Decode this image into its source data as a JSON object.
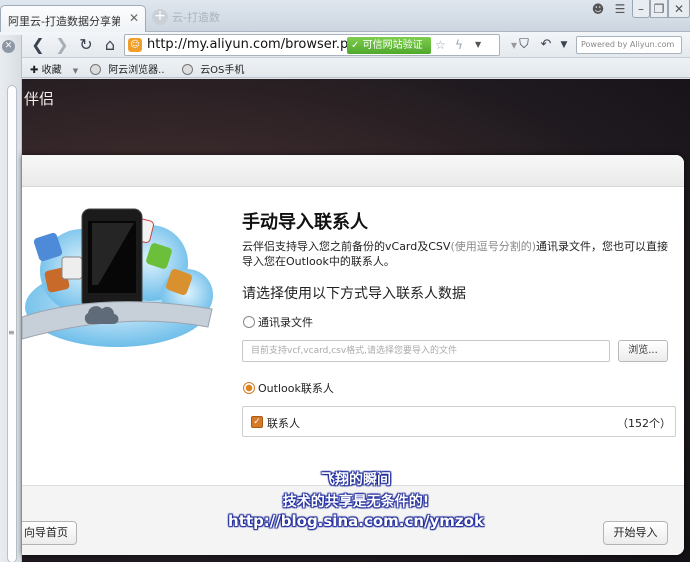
{
  "browser": {
    "tab_title": "阿里云-打造数据分享第一...",
    "tab_close": "✕",
    "new_tab": "+",
    "ghost_tab": "云-打造数",
    "url": "http://my.aliyun.com/browser.php",
    "trust_badge": "可信网站验证",
    "search_placeholder": "Powered by Aliyun.com",
    "bookmarks": [
      {
        "label": "收藏",
        "icon": "star-icon"
      },
      {
        "label": "阿云浏览器..",
        "icon": "globe-icon"
      },
      {
        "label": "云OS手机",
        "icon": "globe-icon"
      }
    ]
  },
  "page": {
    "banner_title": "伴侣"
  },
  "dialog": {
    "heading": "手动导入联系人",
    "desc_part1": "云伴侣支持导入您之前备份的vCard及CSV",
    "desc_grey": "(使用逗号分割的)",
    "desc_part2": "通讯录文件，您也可以直接导入您在Outlook中的联系人。",
    "choose_label": "请选择使用以下方式导入联系人数据",
    "option_file": "通讯录文件",
    "file_placeholder": "目前支持vcf,vcard,csv格式,请选择您要导入的文件",
    "browse_label": "浏览...",
    "option_outlook": "Outlook联系人",
    "contacts_label": "联系人",
    "contacts_count": "（152个）",
    "back_label": "向导首页",
    "start_label": "开始导入"
  },
  "watermark": {
    "line1": "飞翔的瞬间",
    "line2": "技术的共享是无条件的!",
    "line3": "http://blog.sina.com.cn/ymzok"
  },
  "colors": {
    "accent_orange": "#e0831f",
    "trust_green": "#4fa82c",
    "watermark_outline": "#1e2a9a"
  }
}
